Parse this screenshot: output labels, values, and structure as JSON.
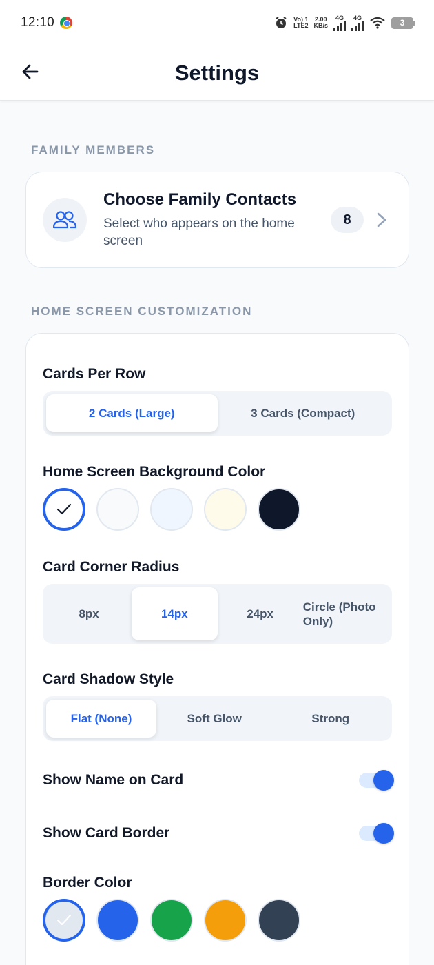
{
  "status_bar": {
    "time": "12:10",
    "volte_top": "Vo) 1",
    "volte_bottom": "LTE2",
    "speed_top": "2.00",
    "speed_bottom": "KB/s",
    "net1": "4G",
    "net2": "4G",
    "battery": "3"
  },
  "header": {
    "title": "Settings"
  },
  "family_section": {
    "label": "FAMILY MEMBERS",
    "card_title": "Choose Family Contacts",
    "card_subtitle": "Select who appears on the home screen",
    "count": "8"
  },
  "custom_section": {
    "label": "HOME SCREEN CUSTOMIZATION",
    "cards_per_row": {
      "label": "Cards Per Row",
      "options": [
        "2 Cards (Large)",
        "3 Cards (Compact)"
      ],
      "selected": 0
    },
    "background_color": {
      "label": "Home Screen Background Color",
      "swatches": [
        "#ffffff",
        "#f8fafc",
        "#eff6ff",
        "#fffbeb",
        "#0f172a"
      ],
      "selected": 0
    },
    "corner_radius": {
      "label": "Card Corner Radius",
      "options": [
        "8px",
        "14px",
        "24px",
        "Circle (Photo Only)"
      ],
      "selected": 1
    },
    "shadow_style": {
      "label": "Card Shadow Style",
      "options": [
        "Flat (None)",
        "Soft Glow",
        "Strong"
      ],
      "selected": 0
    },
    "show_name": {
      "label": "Show Name on Card",
      "on": true
    },
    "show_border": {
      "label": "Show Card Border",
      "on": true
    },
    "border_color": {
      "label": "Border Color",
      "swatches": [
        "#e2e8f0",
        "#2563eb",
        "#16a34a",
        "#f59e0b",
        "#334155"
      ],
      "selected": 0
    }
  },
  "colors": {
    "accent": "#2563eb",
    "text_primary": "#0f172a",
    "text_muted": "#475569",
    "section_label": "#8a97a8"
  }
}
